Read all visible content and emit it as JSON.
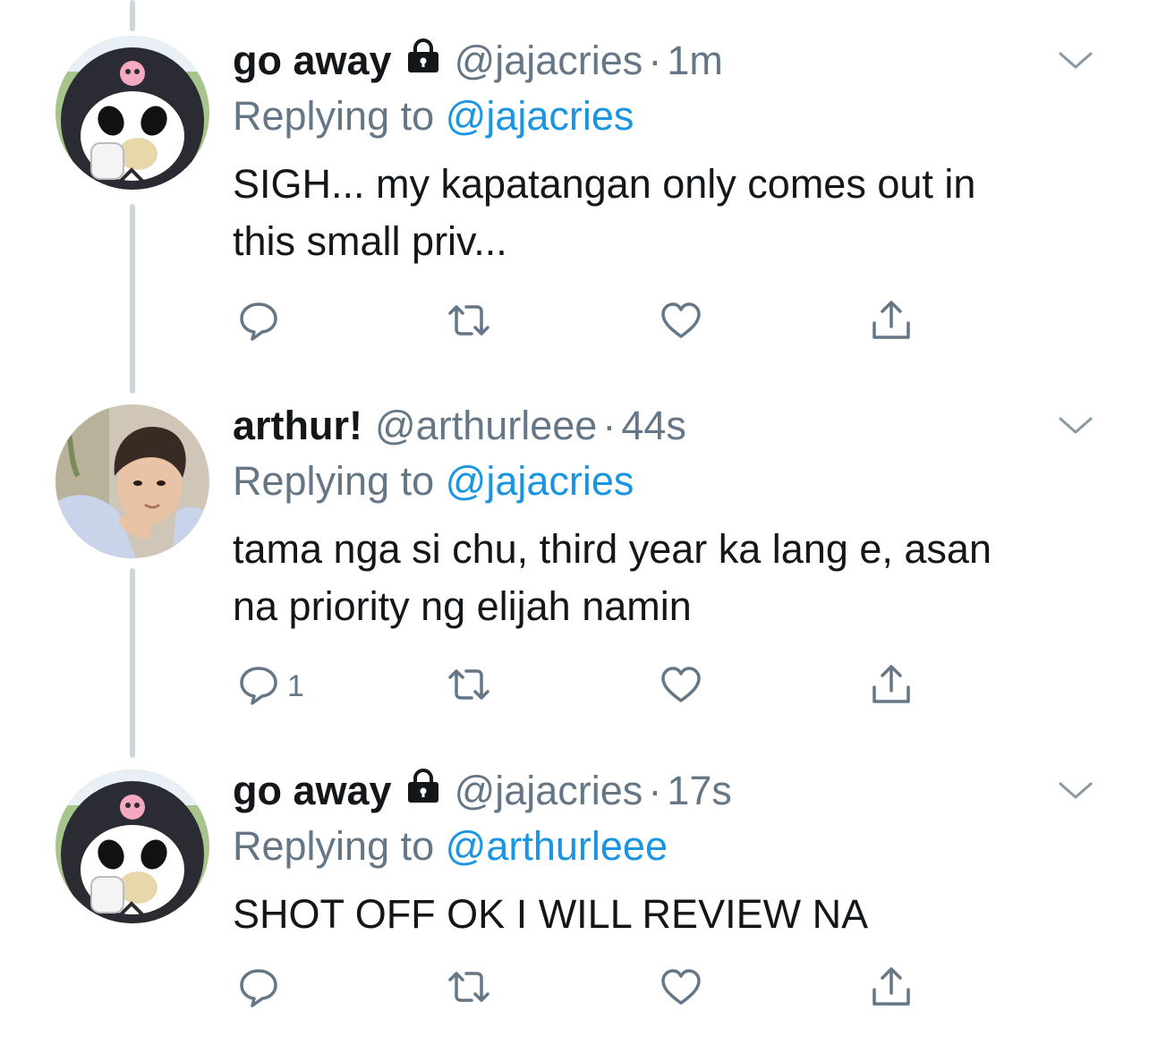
{
  "tweets": [
    {
      "display_name": "go away",
      "handle": "@jajacries",
      "dot": "·",
      "time": "1m",
      "replying_prefix": "Replying to",
      "replying_to": "@jajacries",
      "text": "SIGH... my kapatangan only comes out in\nthis small priv...",
      "reply_count": ""
    },
    {
      "display_name": "arthur!",
      "handle": "@arthurleee",
      "dot": "·",
      "time": "44s",
      "replying_prefix": "Replying to",
      "replying_to": "@jajacries",
      "text": "tama nga si chu, third year ka lang e, asan\nna priority ng elijah namin",
      "reply_count": "1"
    },
    {
      "display_name": "go away",
      "handle": "@jajacries",
      "dot": "·",
      "time": "17s",
      "replying_prefix": "Replying to",
      "replying_to": "@arthurleee",
      "text": "SHOT OFF OK I WILL REVIEW NA",
      "reply_count": ""
    }
  ],
  "icons": {
    "lock": "lock-icon",
    "chevron": "chevron-down-icon",
    "reply": "reply-icon",
    "retweet": "retweet-icon",
    "like": "heart-icon",
    "share": "share-icon"
  },
  "colors": {
    "link": "#1b95e0",
    "secondary": "#657786",
    "thread_line": "#ccd6dd",
    "icon": "#657786"
  }
}
